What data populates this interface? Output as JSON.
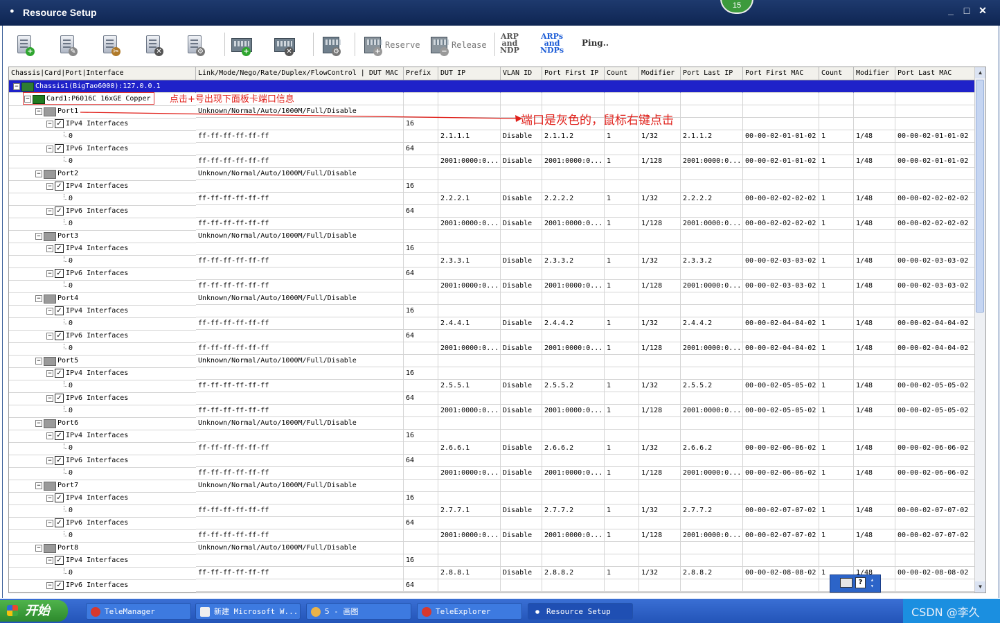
{
  "window": {
    "title": "Resource Setup",
    "badge": "15",
    "controls": [
      "_",
      "□",
      "✕"
    ]
  },
  "toolbar": {
    "reserve_label": "Reserve",
    "release_label": "Release",
    "arp_label": [
      "ARP",
      "and",
      "NDP"
    ],
    "arps_label": [
      "ARPs",
      "and",
      "NDPs"
    ],
    "ping_label": "Ping.."
  },
  "columns": [
    "Chassis|Card|Port|Interface",
    "Link/Mode/Nego/Rate/Duplex/FlowControl | DUT MAC",
    "Prefix",
    "DUT IP",
    "VLAN ID",
    "Port First IP",
    "Count",
    "Modifier",
    "Port Last IP",
    "Port First MAC",
    "Count",
    "Modifier",
    "Port Last MAC"
  ],
  "chassis_label": "Chassis1(BigTao6000):127.0.0.1",
  "card_label": "Card1:P6016C 16xGE Copper",
  "ports": [
    {
      "name": "Port1",
      "link": "Unknown/Normal/Auto/1000M/Full/Disable",
      "v4": {
        "mac": "ff-ff-ff-ff-ff-ff",
        "prefix": "16",
        "dut_ip": "2.1.1.1",
        "vlan": "Disable",
        "first_ip": "2.1.1.2",
        "count": "1",
        "modifier": "1/32",
        "last_ip": "2.1.1.2",
        "first_mac": "00-00-02-01-01-02",
        "mcount": "1",
        "mmod": "1/48",
        "last_mac": "00-00-02-01-01-02"
      },
      "v6": {
        "mac": "ff-ff-ff-ff-ff-ff",
        "prefix": "64",
        "dut_ip": "2001:0000:0...",
        "vlan": "Disable",
        "first_ip": "2001:0000:0...",
        "count": "1",
        "modifier": "1/128",
        "last_ip": "2001:0000:0...",
        "first_mac": "00-00-02-01-01-02",
        "mcount": "1",
        "mmod": "1/48",
        "last_mac": "00-00-02-01-01-02"
      }
    },
    {
      "name": "Port2",
      "link": "Unknown/Normal/Auto/1000M/Full/Disable",
      "v4": {
        "mac": "ff-ff-ff-ff-ff-ff",
        "prefix": "16",
        "dut_ip": "2.2.2.1",
        "vlan": "Disable",
        "first_ip": "2.2.2.2",
        "count": "1",
        "modifier": "1/32",
        "last_ip": "2.2.2.2",
        "first_mac": "00-00-02-02-02-02",
        "mcount": "1",
        "mmod": "1/48",
        "last_mac": "00-00-02-02-02-02"
      },
      "v6": {
        "mac": "ff-ff-ff-ff-ff-ff",
        "prefix": "64",
        "dut_ip": "2001:0000:0...",
        "vlan": "Disable",
        "first_ip": "2001:0000:0...",
        "count": "1",
        "modifier": "1/128",
        "last_ip": "2001:0000:0...",
        "first_mac": "00-00-02-02-02-02",
        "mcount": "1",
        "mmod": "1/48",
        "last_mac": "00-00-02-02-02-02"
      }
    },
    {
      "name": "Port3",
      "link": "Unknown/Normal/Auto/1000M/Full/Disable",
      "v4": {
        "mac": "ff-ff-ff-ff-ff-ff",
        "prefix": "16",
        "dut_ip": "2.3.3.1",
        "vlan": "Disable",
        "first_ip": "2.3.3.2",
        "count": "1",
        "modifier": "1/32",
        "last_ip": "2.3.3.2",
        "first_mac": "00-00-02-03-03-02",
        "mcount": "1",
        "mmod": "1/48",
        "last_mac": "00-00-02-03-03-02"
      },
      "v6": {
        "mac": "ff-ff-ff-ff-ff-ff",
        "prefix": "64",
        "dut_ip": "2001:0000:0...",
        "vlan": "Disable",
        "first_ip": "2001:0000:0...",
        "count": "1",
        "modifier": "1/128",
        "last_ip": "2001:0000:0...",
        "first_mac": "00-00-02-03-03-02",
        "mcount": "1",
        "mmod": "1/48",
        "last_mac": "00-00-02-03-03-02"
      }
    },
    {
      "name": "Port4",
      "link": "Unknown/Normal/Auto/1000M/Full/Disable",
      "v4": {
        "mac": "ff-ff-ff-ff-ff-ff",
        "prefix": "16",
        "dut_ip": "2.4.4.1",
        "vlan": "Disable",
        "first_ip": "2.4.4.2",
        "count": "1",
        "modifier": "1/32",
        "last_ip": "2.4.4.2",
        "first_mac": "00-00-02-04-04-02",
        "mcount": "1",
        "mmod": "1/48",
        "last_mac": "00-00-02-04-04-02"
      },
      "v6": {
        "mac": "ff-ff-ff-ff-ff-ff",
        "prefix": "64",
        "dut_ip": "2001:0000:0...",
        "vlan": "Disable",
        "first_ip": "2001:0000:0...",
        "count": "1",
        "modifier": "1/128",
        "last_ip": "2001:0000:0...",
        "first_mac": "00-00-02-04-04-02",
        "mcount": "1",
        "mmod": "1/48",
        "last_mac": "00-00-02-04-04-02"
      }
    },
    {
      "name": "Port5",
      "link": "Unknown/Normal/Auto/1000M/Full/Disable",
      "v4": {
        "mac": "ff-ff-ff-ff-ff-ff",
        "prefix": "16",
        "dut_ip": "2.5.5.1",
        "vlan": "Disable",
        "first_ip": "2.5.5.2",
        "count": "1",
        "modifier": "1/32",
        "last_ip": "2.5.5.2",
        "first_mac": "00-00-02-05-05-02",
        "mcount": "1",
        "mmod": "1/48",
        "last_mac": "00-00-02-05-05-02"
      },
      "v6": {
        "mac": "ff-ff-ff-ff-ff-ff",
        "prefix": "64",
        "dut_ip": "2001:0000:0...",
        "vlan": "Disable",
        "first_ip": "2001:0000:0...",
        "count": "1",
        "modifier": "1/128",
        "last_ip": "2001:0000:0...",
        "first_mac": "00-00-02-05-05-02",
        "mcount": "1",
        "mmod": "1/48",
        "last_mac": "00-00-02-05-05-02"
      }
    },
    {
      "name": "Port6",
      "link": "Unknown/Normal/Auto/1000M/Full/Disable",
      "v4": {
        "mac": "ff-ff-ff-ff-ff-ff",
        "prefix": "16",
        "dut_ip": "2.6.6.1",
        "vlan": "Disable",
        "first_ip": "2.6.6.2",
        "count": "1",
        "modifier": "1/32",
        "last_ip": "2.6.6.2",
        "first_mac": "00-00-02-06-06-02",
        "mcount": "1",
        "mmod": "1/48",
        "last_mac": "00-00-02-06-06-02"
      },
      "v6": {
        "mac": "ff-ff-ff-ff-ff-ff",
        "prefix": "64",
        "dut_ip": "2001:0000:0...",
        "vlan": "Disable",
        "first_ip": "2001:0000:0...",
        "count": "1",
        "modifier": "1/128",
        "last_ip": "2001:0000:0...",
        "first_mac": "00-00-02-06-06-02",
        "mcount": "1",
        "mmod": "1/48",
        "last_mac": "00-00-02-06-06-02"
      }
    },
    {
      "name": "Port7",
      "link": "Unknown/Normal/Auto/1000M/Full/Disable",
      "v4": {
        "mac": "ff-ff-ff-ff-ff-ff",
        "prefix": "16",
        "dut_ip": "2.7.7.1",
        "vlan": "Disable",
        "first_ip": "2.7.7.2",
        "count": "1",
        "modifier": "1/32",
        "last_ip": "2.7.7.2",
        "first_mac": "00-00-02-07-07-02",
        "mcount": "1",
        "mmod": "1/48",
        "last_mac": "00-00-02-07-07-02"
      },
      "v6": {
        "mac": "ff-ff-ff-ff-ff-ff",
        "prefix": "64",
        "dut_ip": "2001:0000:0...",
        "vlan": "Disable",
        "first_ip": "2001:0000:0...",
        "count": "1",
        "modifier": "1/128",
        "last_ip": "2001:0000:0...",
        "first_mac": "00-00-02-07-07-02",
        "mcount": "1",
        "mmod": "1/48",
        "last_mac": "00-00-02-07-07-02"
      }
    },
    {
      "name": "Port8",
      "link": "Unknown/Normal/Auto/1000M/Full/Disable",
      "v4": {
        "mac": "ff-ff-ff-ff-ff-ff",
        "prefix": "16",
        "dut_ip": "2.8.8.1",
        "vlan": "Disable",
        "first_ip": "2.8.8.2",
        "count": "1",
        "modifier": "1/32",
        "last_ip": "2.8.8.2",
        "first_mac": "00-00-02-08-08-02",
        "mcount": "1",
        "mmod": "1/48",
        "last_mac": "00-00-02-08-08-02"
      },
      "v6": {
        "prefix": "64"
      }
    }
  ],
  "tree_labels": {
    "ipv4": "IPv4 Interfaces",
    "ipv6": "IPv6 Interfaces",
    "iface_index": "0"
  },
  "annotations": {
    "card_note": "点击+号出现下面板卡端口信息",
    "port_note": "端口是灰色的，鼠标右键点击"
  },
  "taskbar": {
    "start_label": "开始",
    "tasks": [
      "TeleManager",
      "新建 Microsoft W...",
      "5 - 画图",
      "TeleExplorer",
      "Resource Setup"
    ],
    "watermark": "CSDN @李久"
  }
}
